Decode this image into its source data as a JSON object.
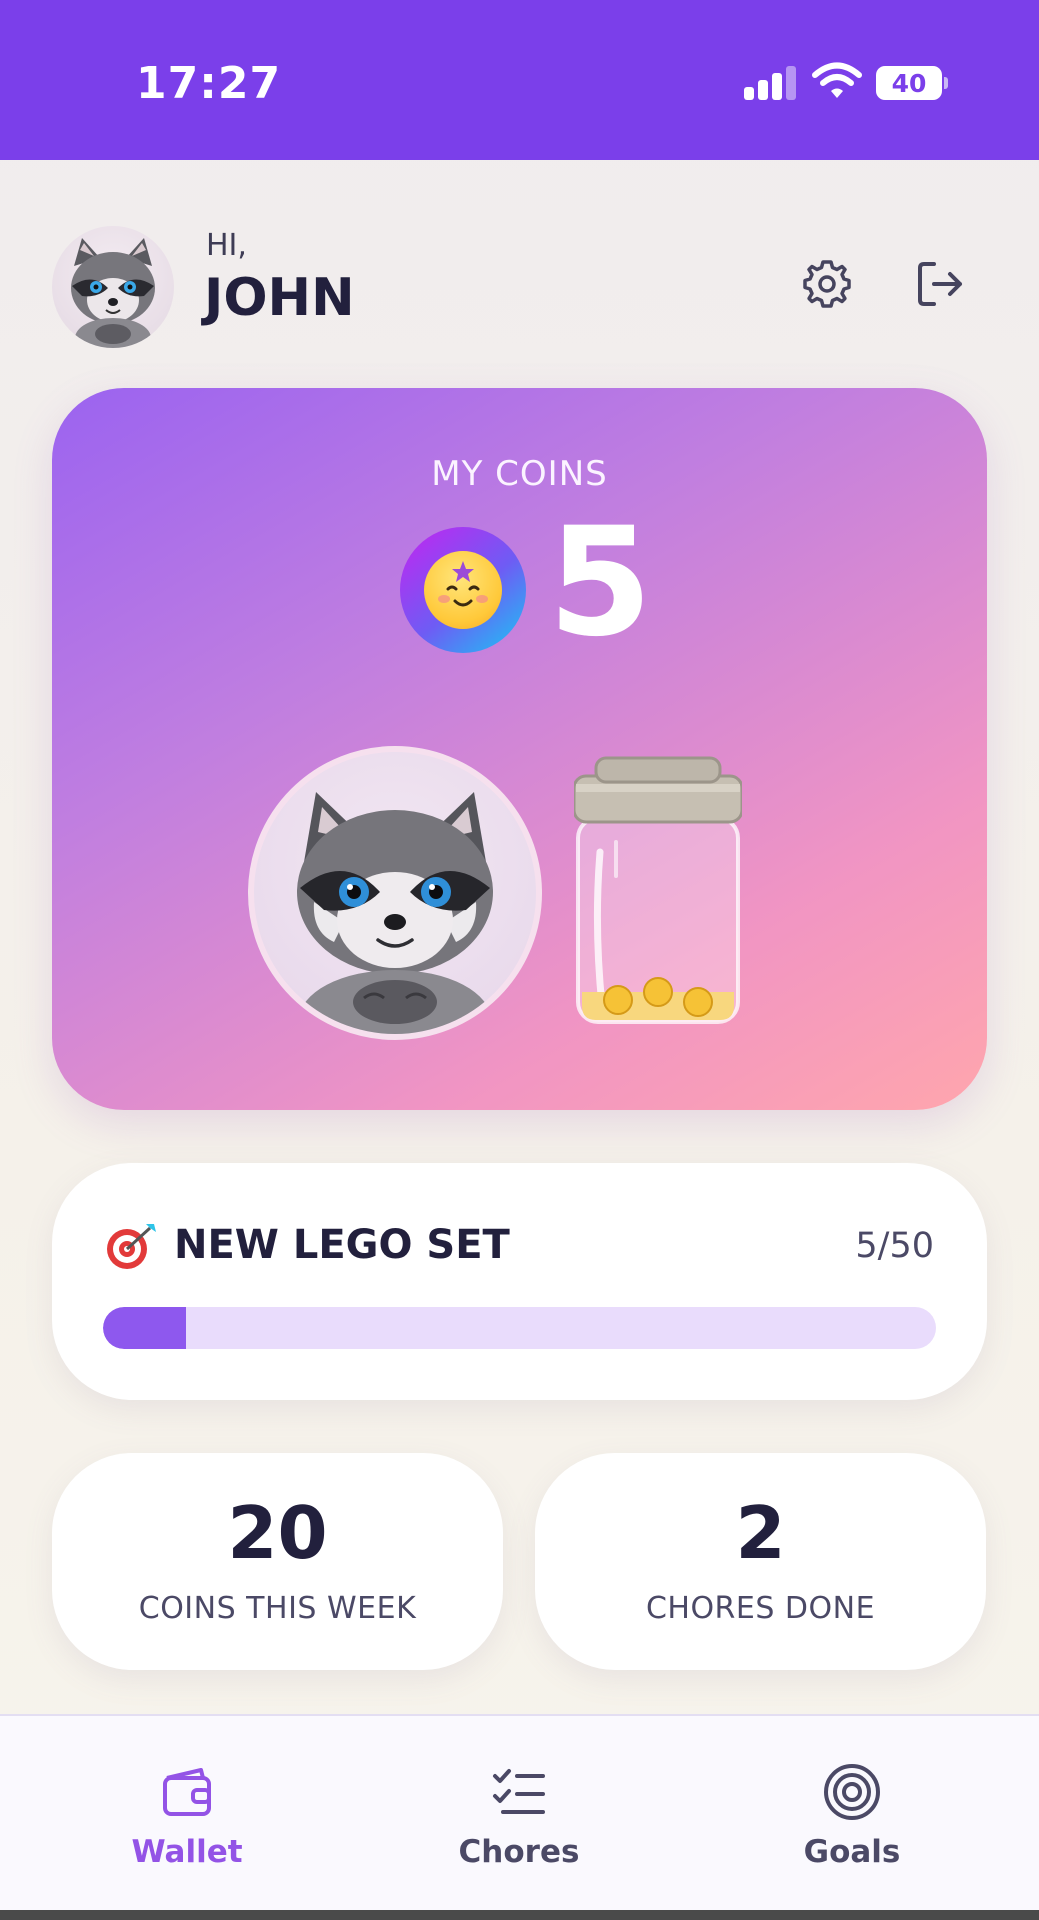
{
  "status_bar": {
    "time": "17:27",
    "battery": "40"
  },
  "header": {
    "greeting": "HI,",
    "name": "JOHN"
  },
  "coins_card": {
    "label": "MY COINS",
    "count": "5"
  },
  "goal": {
    "title": "NEW LEGO SET",
    "progress_text": "5/50",
    "progress_fraction": 0.1
  },
  "stats": [
    {
      "value": "20",
      "label": "COINS THIS WEEK"
    },
    {
      "value": "2",
      "label": "CHORES DONE"
    }
  ],
  "nav": [
    {
      "label": "Wallet",
      "active": true
    },
    {
      "label": "Chores",
      "active": false
    },
    {
      "label": "Goals",
      "active": false
    }
  ],
  "colors": {
    "brand_purple": "#7b3fea",
    "active_nav": "#9353e6",
    "inactive_nav": "#4b4966",
    "progress_fill": "#8e58ee",
    "progress_track": "#e9dcfc"
  }
}
